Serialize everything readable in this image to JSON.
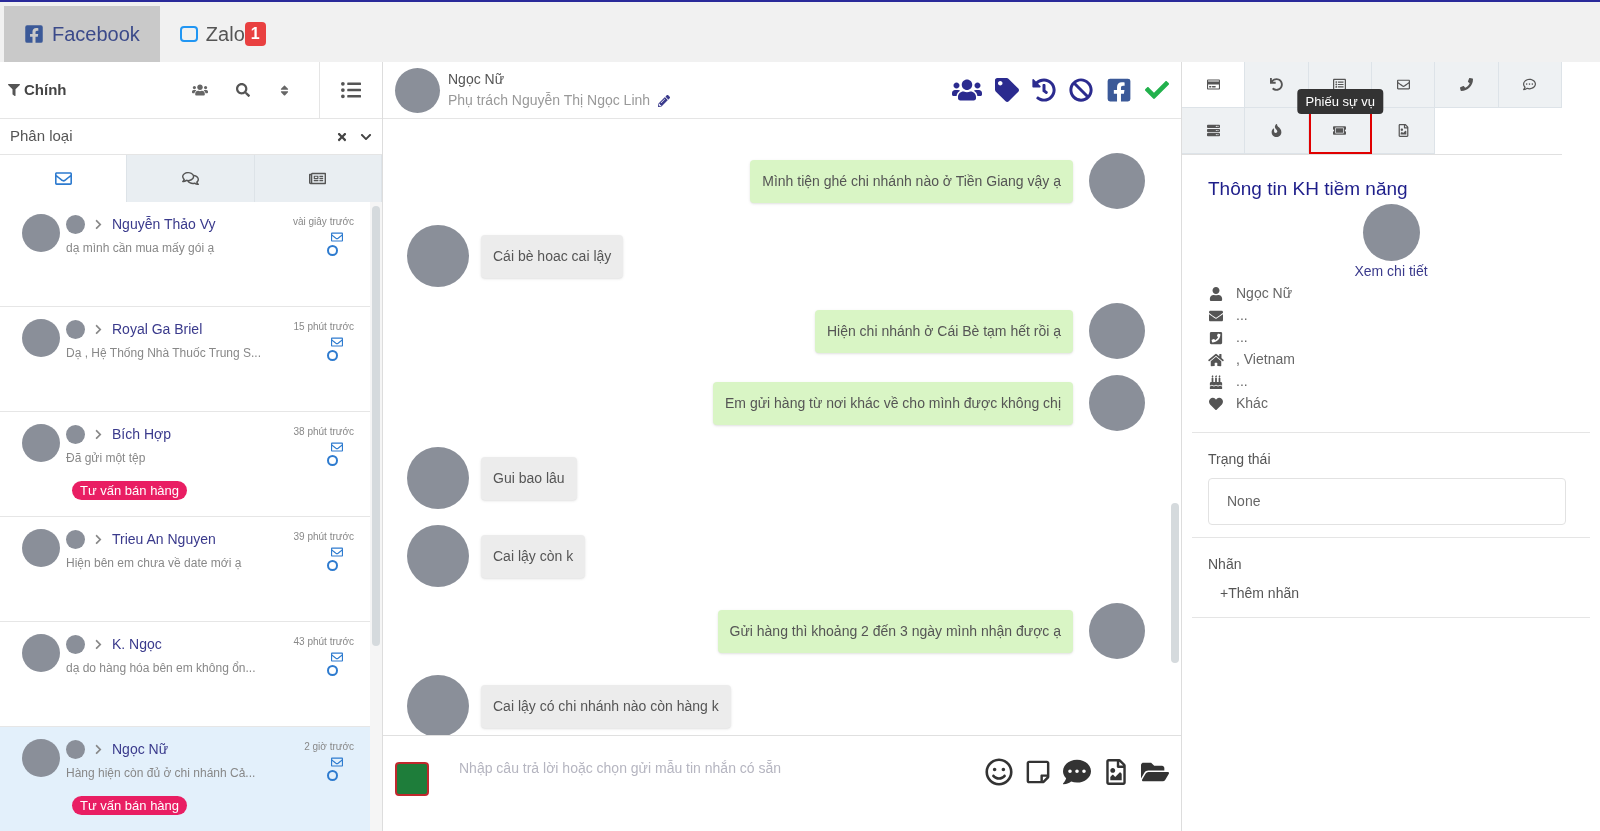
{
  "platform_tabs": [
    {
      "label": "Facebook",
      "selected": true
    },
    {
      "label": "Zalo",
      "selected": false,
      "badge": "1"
    }
  ],
  "filter": {
    "label": "Chính"
  },
  "category": {
    "label": "Phân loại"
  },
  "list_tabs": [
    {
      "selected": true
    },
    {
      "selected": false
    },
    {
      "selected": false
    }
  ],
  "conversations": [
    {
      "name": "Nguyễn Thảo Vy",
      "preview": "dạ mình cần mua mấy gói ạ",
      "time": "vài giây trước",
      "selected": false
    },
    {
      "name": "Royal Ga Briel",
      "preview": "Dạ , Hệ Thống Nhà Thuốc Trung S...",
      "time": "15 phút trước",
      "selected": false
    },
    {
      "name": "Bích Hợp",
      "preview": "Đã gửi một tệp",
      "time": "38 phút trước",
      "selected": false,
      "tag": "Tư vấn bán hàng"
    },
    {
      "name": "Trieu An Nguyen",
      "preview": "Hiện bên em chưa về date mới ạ",
      "time": "39 phút trước",
      "selected": false
    },
    {
      "name": "K. Ngọc",
      "preview": "dạ do hàng hóa bên em không ổn...",
      "time": "43 phút trước",
      "selected": false
    },
    {
      "name": "Ngọc Nữ",
      "preview": "Hàng hiện còn đủ ở chi nhánh Cả...",
      "time": "2 giờ trước",
      "selected": true,
      "tag": "Tư vấn bán hàng"
    }
  ],
  "chat_header": {
    "name": "Ngọc Nữ",
    "assignee": "Phụ trách Nguyễn Thị Ngọc Linh"
  },
  "messages": [
    {
      "kind": "out",
      "text": "Mình tiện ghé chi nhánh nào ở Tiền Giang vậy ạ"
    },
    {
      "kind": "in",
      "text": "Cái bè hoac cai lậy"
    },
    {
      "kind": "out",
      "text": "Hiện chi nhánh ở Cái Bè tạm hết rồi ạ"
    },
    {
      "kind": "out",
      "text": "Em gửi hàng từ nơi khác về cho mình được không chị"
    },
    {
      "kind": "in",
      "text": "Gui bao lâu"
    },
    {
      "kind": "in",
      "text": "Cai lậy còn k"
    },
    {
      "kind": "out",
      "text": "Gửi hàng thì khoảng 2 đến 3 ngày mình nhận được ạ"
    },
    {
      "kind": "in",
      "text": "Cai lậy có chi nhánh nào còn hàng k"
    }
  ],
  "composer": {
    "placeholder": "Nhập câu trả lời hoặc chọn gửi mẫu tin nhắn có sẵn"
  },
  "info_tabs": [
    {
      "selected": true,
      "highlighted": false
    },
    {
      "selected": false,
      "highlighted": false
    },
    {
      "selected": false,
      "highlighted": false
    },
    {
      "selected": false,
      "highlighted": false
    },
    {
      "selected": false,
      "highlighted": false
    },
    {
      "selected": false,
      "highlighted": false
    },
    {
      "selected": false,
      "highlighted": false
    },
    {
      "selected": false,
      "highlighted": false
    },
    {
      "selected": false,
      "highlighted": true,
      "tooltip": "Phiếu sự vụ"
    },
    {
      "selected": false,
      "highlighted": false
    }
  ],
  "customer": {
    "title": "Thông tin KH tiềm năng",
    "detail_link": "Xem chi tiết",
    "fields": [
      "Ngọc Nữ",
      "...",
      "...",
      ", Vietnam",
      "...",
      "Khác"
    ]
  },
  "status": {
    "label": "Trạng thái",
    "value": "None"
  },
  "labels": {
    "label": "Nhãn",
    "add": "+Thêm nhãn"
  }
}
